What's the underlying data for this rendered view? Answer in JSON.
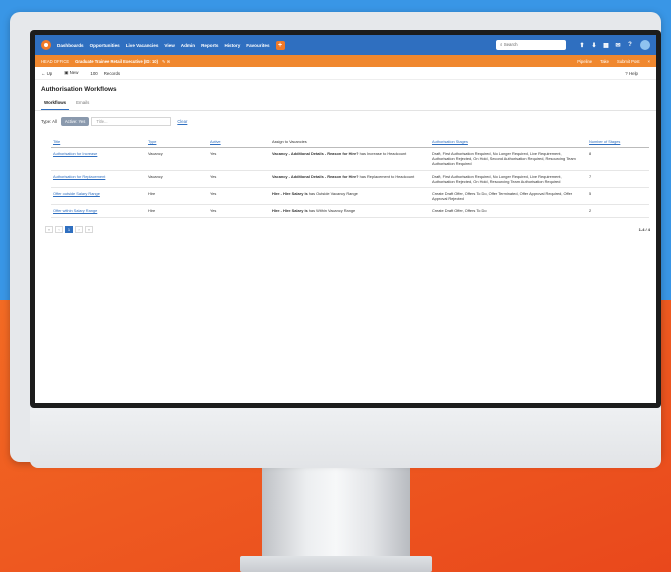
{
  "nav": {
    "items": [
      "Dashboards",
      "Opportunities",
      "Live Vacancies",
      "View",
      "Admin",
      "Reports",
      "History",
      "Favourites"
    ],
    "add_label": "+",
    "search_placeholder": "Search"
  },
  "office": {
    "label": "HEAD OFFICE",
    "title": "Graduate Trainee Retail Executive (ID: 10)",
    "actions": [
      "Pipeline",
      "Take",
      "Submit Post"
    ]
  },
  "toolbar": {
    "up": "Up",
    "new": "New",
    "records_count": "100",
    "records_label": "Records",
    "help": "Help"
  },
  "page": {
    "title": "Authorisation Workflows"
  },
  "tabs": [
    "Workflows",
    "Emails"
  ],
  "filters": {
    "type_label": "Type: All",
    "active_chip": "Active: Yes",
    "title_placeholder": "Title...",
    "clear": "Clear"
  },
  "table": {
    "headers": [
      "Title",
      "Type",
      "Active",
      "Assign to Vacancies",
      "Authorisation Stages",
      "Number of Stages"
    ],
    "rows": [
      {
        "title": "Authorisation for Increase",
        "type": "Vacancy",
        "active": "Yes",
        "assign_bold": "Vacancy - Additional Details - Reason for Hire?",
        "assign_rest": " has Increase to Headcount",
        "stages": "Draft, First Authorisation Required, No Longer Required, Live Requirement, Authorisation Rejected, On Hold, Second Authorisation Required, Resourcing Team Authorisation Required",
        "count": "8"
      },
      {
        "title": "Authorisation for Replacement",
        "type": "Vacancy",
        "active": "Yes",
        "assign_bold": "Vacancy - Additional Details - Reason for Hire?",
        "assign_rest": " has Replacement to Headcount",
        "stages": "Draft, First Authorisation Required, No Longer Required, Live Requirement, Authorisation Rejected, On Hold, Resourcing Team Authorisation Required",
        "count": "7"
      },
      {
        "title": "Offer outside Salary Range",
        "type": "Hire",
        "active": "Yes",
        "assign_bold": "Hire - Hire Salary is",
        "assign_rest": " has Outside Vacancy Range",
        "stages": "Create Draft Offer, Offers To Do, Offer Terminated, Offer Approval Required, Offer Approval Rejected",
        "count": "5"
      },
      {
        "title": "Offer within Salary Range",
        "type": "Hire",
        "active": "Yes",
        "assign_bold": "Hire - Hire Salary is",
        "assign_rest": " has Within Vacancy Range",
        "stages": "Create Draft Offer, Offers To Do",
        "count": "2"
      }
    ]
  },
  "pager": {
    "buttons": [
      "«",
      "‹",
      "1",
      "›",
      "»"
    ],
    "summary": "1-4 / 4"
  },
  "colors": {
    "nav": "#2f6fc0",
    "office": "#f0882f",
    "accent": "#f07a2a"
  }
}
